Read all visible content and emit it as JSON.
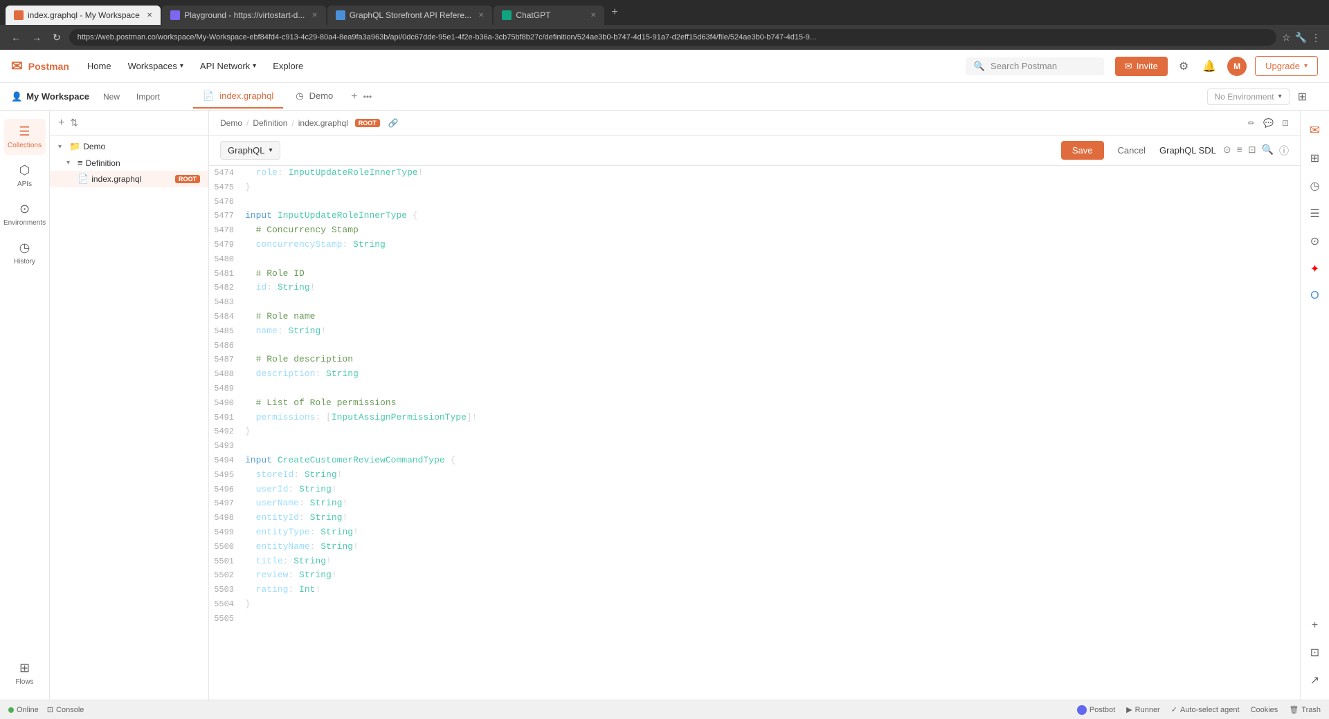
{
  "browser": {
    "tabs": [
      {
        "id": "tab1",
        "title": "index.graphql - My Workspace",
        "favicon_color": "#e06c3e",
        "favicon_text": "P",
        "active": true
      },
      {
        "id": "tab2",
        "title": "Playground - https://virtostart-d...",
        "favicon_color": "#7b68ee",
        "favicon_text": "P",
        "active": false
      },
      {
        "id": "tab3",
        "title": "GraphQL Storefront API Refere...",
        "favicon_color": "#4a90d9",
        "favicon_text": "G",
        "active": false
      },
      {
        "id": "tab4",
        "title": "ChatGPT",
        "favicon_color": "#10a37f",
        "favicon_text": "C",
        "active": false
      }
    ],
    "url": "https://web.postman.co/workspace/My-Workspace-ebf84fd4-c913-4c29-80a4-8ea9fa3a963b/api/0dc67dde-95e1-4f2e-b36a-3cb75bf8b27c/definition/524ae3b0-b747-4d15-91a7-d2eff15d63f4/file/524ae3b0-b747-4d15-9..."
  },
  "app": {
    "header": {
      "logo": "Postman",
      "nav_items": [
        "Home",
        "Workspaces",
        "API Network",
        "Explore"
      ],
      "search_placeholder": "Search Postman",
      "invite_label": "Invite",
      "env_label": "No Environment"
    },
    "workspace": {
      "title": "My Workspace",
      "new_label": "New",
      "import_label": "Import"
    },
    "sidebar": {
      "items": [
        {
          "id": "collections",
          "icon": "☰",
          "label": "Collections"
        },
        {
          "id": "apis",
          "icon": "⬡",
          "label": "APIs"
        },
        {
          "id": "environments",
          "icon": "⊙",
          "label": "Environments"
        },
        {
          "id": "history",
          "icon": "◷",
          "label": "History"
        },
        {
          "id": "flows",
          "icon": "⊞",
          "label": "Flows"
        }
      ]
    },
    "file_tree": {
      "collections_label": "Demo",
      "items": [
        {
          "id": "demo",
          "label": "Demo",
          "type": "folder",
          "level": 0,
          "expanded": true
        },
        {
          "id": "definition",
          "label": "Definition",
          "type": "schema",
          "level": 1,
          "expanded": true
        },
        {
          "id": "index-graphql",
          "label": "index.graphql",
          "type": "file",
          "level": 2,
          "badge": "ROOT"
        }
      ]
    },
    "editor": {
      "tabs": [
        {
          "id": "tab-index",
          "label": "index.graphql",
          "icon": "📄",
          "active": true
        },
        {
          "id": "tab-demo",
          "label": "Demo",
          "icon": "◷",
          "active": false
        }
      ],
      "breadcrumb": {
        "items": [
          "Demo",
          "Definition",
          "index.graphql"
        ],
        "badge": "ROOT"
      },
      "toolbar": {
        "graphql_label": "GraphQL",
        "save_label": "Save",
        "cancel_label": "Cancel",
        "graphql_sdl_label": "GraphQL SDL"
      },
      "code": {
        "lines": [
          {
            "num": "5474",
            "content": "  role: InputUpdateRoleInnerType!",
            "type": "field"
          },
          {
            "num": "5475",
            "content": "}",
            "type": "punct"
          },
          {
            "num": "5476",
            "content": "",
            "type": "empty"
          },
          {
            "num": "5477",
            "content": "input InputUpdateRoleInnerType {",
            "type": "keyword"
          },
          {
            "num": "5478",
            "content": "  # Concurrency Stamp",
            "type": "comment"
          },
          {
            "num": "5479",
            "content": "  concurrencyStamp: String",
            "type": "field"
          },
          {
            "num": "5480",
            "content": "",
            "type": "empty"
          },
          {
            "num": "5481",
            "content": "  # Role ID",
            "type": "comment"
          },
          {
            "num": "5482",
            "content": "  id: String!",
            "type": "field"
          },
          {
            "num": "5483",
            "content": "",
            "type": "empty"
          },
          {
            "num": "5484",
            "content": "  # Role name",
            "type": "comment"
          },
          {
            "num": "5485",
            "content": "  name: String!",
            "type": "field"
          },
          {
            "num": "5486",
            "content": "",
            "type": "empty"
          },
          {
            "num": "5487",
            "content": "  # Role description",
            "type": "comment"
          },
          {
            "num": "5488",
            "content": "  description: String",
            "type": "field"
          },
          {
            "num": "5489",
            "content": "",
            "type": "empty"
          },
          {
            "num": "5490",
            "content": "  # List of Role permissions",
            "type": "comment"
          },
          {
            "num": "5491",
            "content": "  permissions: [InputAssignPermissionType]!",
            "type": "field"
          },
          {
            "num": "5492",
            "content": "}",
            "type": "punct"
          },
          {
            "num": "5493",
            "content": "",
            "type": "empty"
          },
          {
            "num": "5494",
            "content": "input CreateCustomerReviewCommandType {",
            "type": "keyword"
          },
          {
            "num": "5495",
            "content": "  storeId: String!",
            "type": "field"
          },
          {
            "num": "5496",
            "content": "  userId: String!",
            "type": "field"
          },
          {
            "num": "5497",
            "content": "  userName: String!",
            "type": "field"
          },
          {
            "num": "5498",
            "content": "  entityId: String!",
            "type": "field"
          },
          {
            "num": "5499",
            "content": "  entityType: String!",
            "type": "field"
          },
          {
            "num": "5500",
            "content": "  entityName: String!",
            "type": "field"
          },
          {
            "num": "5501",
            "content": "  title: String!",
            "type": "field"
          },
          {
            "num": "5502",
            "content": "  review: String!",
            "type": "field"
          },
          {
            "num": "5503",
            "content": "  rating: Int!",
            "type": "field"
          },
          {
            "num": "5504",
            "content": "}",
            "type": "punct"
          },
          {
            "num": "5505",
            "content": "",
            "type": "empty"
          }
        ]
      }
    },
    "status_bar": {
      "online_label": "Online",
      "console_label": "Console",
      "postbot_label": "Postbot",
      "runner_label": "Runner",
      "auto_select_label": "Auto-select agent",
      "cookies_label": "Cookies",
      "trash_label": "Trash"
    }
  }
}
